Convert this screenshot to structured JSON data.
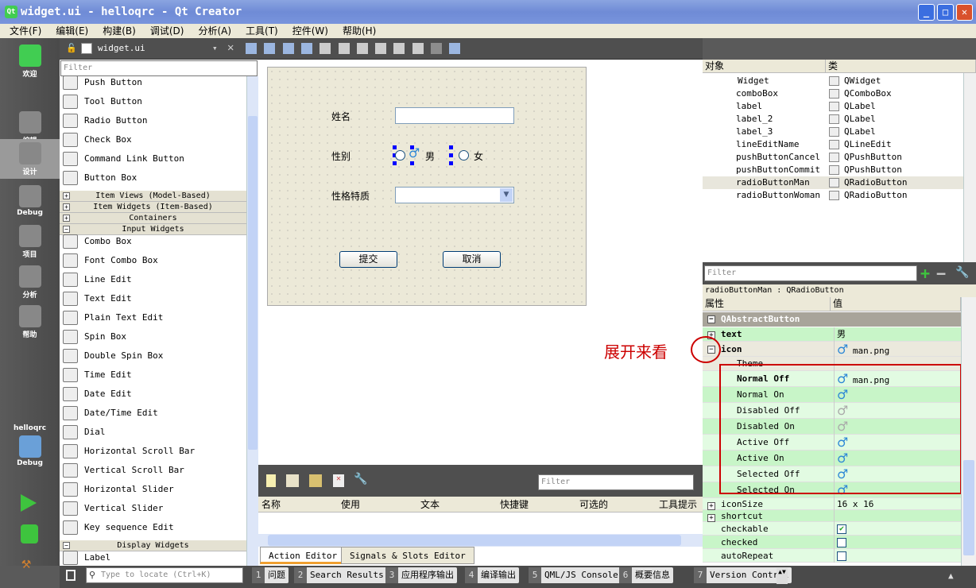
{
  "window": {
    "title": "widget.ui - helloqrc - Qt Creator",
    "logo": "Qt",
    "min": "_",
    "max": "□",
    "close": "✕"
  },
  "menu": [
    "文件(F)",
    "编辑(E)",
    "构建(B)",
    "调试(D)",
    "分析(A)",
    "工具(T)",
    "控件(W)",
    "帮助(H)"
  ],
  "modes": [
    {
      "label": "欢迎",
      "icon": "qt-logo-icon"
    },
    {
      "label": "编辑",
      "icon": "edit-icon"
    },
    {
      "label": "设计",
      "icon": "design-icon"
    },
    {
      "label": "Debug",
      "icon": "debug-icon"
    },
    {
      "label": "项目",
      "icon": "project-icon"
    },
    {
      "label": "分析",
      "icon": "analyze-icon"
    },
    {
      "label": "帮助",
      "icon": "help-icon"
    }
  ],
  "target": {
    "project": "helloqrc",
    "mode": "Debug"
  },
  "toolbar": {
    "file": "widget.ui"
  },
  "widgetbox": {
    "filter_placeholder": "Filter",
    "items": [
      {
        "t": "item",
        "label": "Push Button"
      },
      {
        "t": "item",
        "label": "Tool Button"
      },
      {
        "t": "item",
        "label": "Radio Button"
      },
      {
        "t": "item",
        "label": "Check Box"
      },
      {
        "t": "item",
        "label": "Command Link Button"
      },
      {
        "t": "item",
        "label": "Button Box"
      },
      {
        "t": "cat",
        "label": "Item Views (Model-Based)",
        "sign": "+"
      },
      {
        "t": "cat",
        "label": "Item Widgets (Item-Based)",
        "sign": "+"
      },
      {
        "t": "cat",
        "label": "Containers",
        "sign": "+"
      },
      {
        "t": "cat",
        "label": "Input Widgets",
        "sign": "-"
      },
      {
        "t": "item",
        "label": "Combo Box"
      },
      {
        "t": "item",
        "label": "Font Combo Box"
      },
      {
        "t": "item",
        "label": "Line Edit"
      },
      {
        "t": "item",
        "label": "Text Edit"
      },
      {
        "t": "item",
        "label": "Plain Text Edit"
      },
      {
        "t": "item",
        "label": "Spin Box"
      },
      {
        "t": "item",
        "label": "Double Spin Box"
      },
      {
        "t": "item",
        "label": "Time Edit"
      },
      {
        "t": "item",
        "label": "Date Edit"
      },
      {
        "t": "item",
        "label": "Date/Time Edit"
      },
      {
        "t": "item",
        "label": "Dial"
      },
      {
        "t": "item",
        "label": "Horizontal Scroll Bar"
      },
      {
        "t": "item",
        "label": "Vertical Scroll Bar"
      },
      {
        "t": "item",
        "label": "Horizontal Slider"
      },
      {
        "t": "item",
        "label": "Vertical Slider"
      },
      {
        "t": "item",
        "label": "Key sequence Edit"
      },
      {
        "t": "cat",
        "label": "Display Widgets",
        "sign": "-"
      },
      {
        "t": "item",
        "label": "Label"
      }
    ]
  },
  "form": {
    "name_label": "姓名",
    "gender_label": "性别",
    "male": "男",
    "female": "女",
    "trait_label": "性格特质",
    "commit": "提交",
    "cancel": "取消"
  },
  "action_editor": {
    "filter_placeholder": "Filter",
    "columns": [
      "名称",
      "使用",
      "文本",
      "快捷键",
      "可选的",
      "工具提示"
    ],
    "tabs": [
      "Action Editor",
      "Signals & Slots Editor"
    ]
  },
  "object_inspector": {
    "headers": [
      "对象",
      "类"
    ],
    "rows": [
      {
        "o": "Widget",
        "c": "QWidget"
      },
      {
        "o": "comboBox",
        "c": "QComboBox"
      },
      {
        "o": "label",
        "c": "QLabel"
      },
      {
        "o": "label_2",
        "c": "QLabel"
      },
      {
        "o": "label_3",
        "c": "QLabel"
      },
      {
        "o": "lineEditName",
        "c": "QLineEdit"
      },
      {
        "o": "pushButtonCancel",
        "c": "QPushButton"
      },
      {
        "o": "pushButtonCommit",
        "c": "QPushButton"
      },
      {
        "o": "radioButtonMan",
        "c": "QRadioButton"
      },
      {
        "o": "radioButtonWoman",
        "c": "QRadioButton"
      }
    ]
  },
  "property_editor": {
    "filter_placeholder": "Filter",
    "class_line": "radioButtonMan : QRadioButton",
    "headers": [
      "属性",
      "值"
    ],
    "group": "QAbstractButton",
    "rows": [
      {
        "n": "text",
        "v": "男",
        "bold": true,
        "exp": "+",
        "lvl": 0
      },
      {
        "n": "icon",
        "v": "man.png",
        "bold": true,
        "exp": "-",
        "lvl": 0,
        "icon": "on"
      },
      {
        "n": "Theme",
        "v": "",
        "lvl": 1
      },
      {
        "n": "Normal Off",
        "v": "man.png",
        "bold": true,
        "lvl": 1,
        "icon": "on"
      },
      {
        "n": "Normal On",
        "v": "",
        "lvl": 1,
        "icon": "on"
      },
      {
        "n": "Disabled Off",
        "v": "",
        "lvl": 1,
        "icon": "dis"
      },
      {
        "n": "Disabled On",
        "v": "",
        "lvl": 1,
        "icon": "dis"
      },
      {
        "n": "Active Off",
        "v": "",
        "lvl": 1,
        "icon": "on"
      },
      {
        "n": "Active On",
        "v": "",
        "lvl": 1,
        "icon": "on"
      },
      {
        "n": "Selected Off",
        "v": "",
        "lvl": 1,
        "icon": "on"
      },
      {
        "n": "Selected On",
        "v": "",
        "lvl": 1,
        "icon": "on"
      },
      {
        "n": "iconSize",
        "v": "16 x 16",
        "exp": "+",
        "lvl": 0
      },
      {
        "n": "shortcut",
        "v": "",
        "exp": "+",
        "lvl": 0
      },
      {
        "n": "checkable",
        "v": "",
        "lvl": 0,
        "check": true
      },
      {
        "n": "checked",
        "v": "",
        "lvl": 0,
        "check": false
      },
      {
        "n": "autoRepeat",
        "v": "",
        "lvl": 0,
        "check": false
      }
    ]
  },
  "annotation": {
    "text": "展开来看",
    "color": "#cc0000"
  },
  "status": {
    "locate_placeholder": "Type to locate (Ctrl+K)",
    "panes": [
      {
        "n": "1",
        "l": "问题"
      },
      {
        "n": "2",
        "l": "Search Results"
      },
      {
        "n": "3",
        "l": "应用程序输出"
      },
      {
        "n": "4",
        "l": "编译输出"
      },
      {
        "n": "5",
        "l": "QML/JS Console"
      },
      {
        "n": "6",
        "l": "概要信息"
      },
      {
        "n": "7",
        "l": "Version Control"
      }
    ]
  },
  "colors": {
    "prop_row": "#c8f5c8",
    "prop_row_alt": "#e2fbe2",
    "group_header": "#a8a49a",
    "highlight_box": "#cc0000"
  }
}
